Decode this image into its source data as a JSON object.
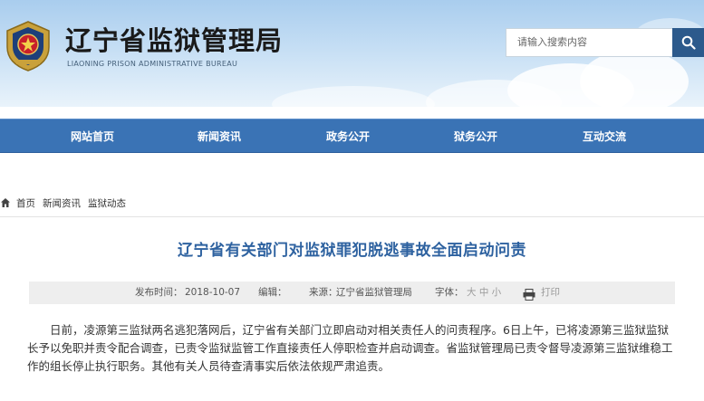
{
  "header": {
    "title": "辽宁省监狱管理局",
    "subtitle": "LIAONING PRISON ADMINISTRATIVE BUREAU",
    "emblem_icon": "police-emblem-icon",
    "search": {
      "placeholder": "请输入搜索内容",
      "button_icon": "search-icon"
    }
  },
  "nav": {
    "items": [
      {
        "label": "网站首页"
      },
      {
        "label": "新闻资讯"
      },
      {
        "label": "政务公开"
      },
      {
        "label": "狱务公开"
      },
      {
        "label": "互动交流"
      }
    ]
  },
  "breadcrumb": {
    "home_icon": "home-icon",
    "items": [
      "首页",
      "新闻资讯",
      "监狱动态"
    ]
  },
  "article": {
    "title": "辽宁省有关部门对监狱罪犯脱逃事故全面启动问责",
    "meta": {
      "date_label": "发布时间：",
      "date": "2018-10-07",
      "editor_label": "编辑：",
      "source_label": "来源：",
      "source": "辽宁省监狱管理局",
      "font_label": "字体：",
      "font_sizes": "大 中 小",
      "print_icon": "printer-icon",
      "print_label": "打印"
    },
    "body": "日前，凌源第三监狱两名逃犯落网后，辽宁省有关部门立即启动对相关责任人的问责程序。6日上午，已将凌源第三监狱监狱长予以免职并责令配合调查，已责令监狱监管工作直接责任人停职检查并启动调查。省监狱管理局已责令督导凌源第三监狱维稳工作的组长停止执行职务。其他有关人员待查清事实后依法依规严肃追责。"
  },
  "colors": {
    "nav_bg": "#3a73b5",
    "title_blue": "#2e62a0",
    "search_button": "#2c5a8c"
  }
}
